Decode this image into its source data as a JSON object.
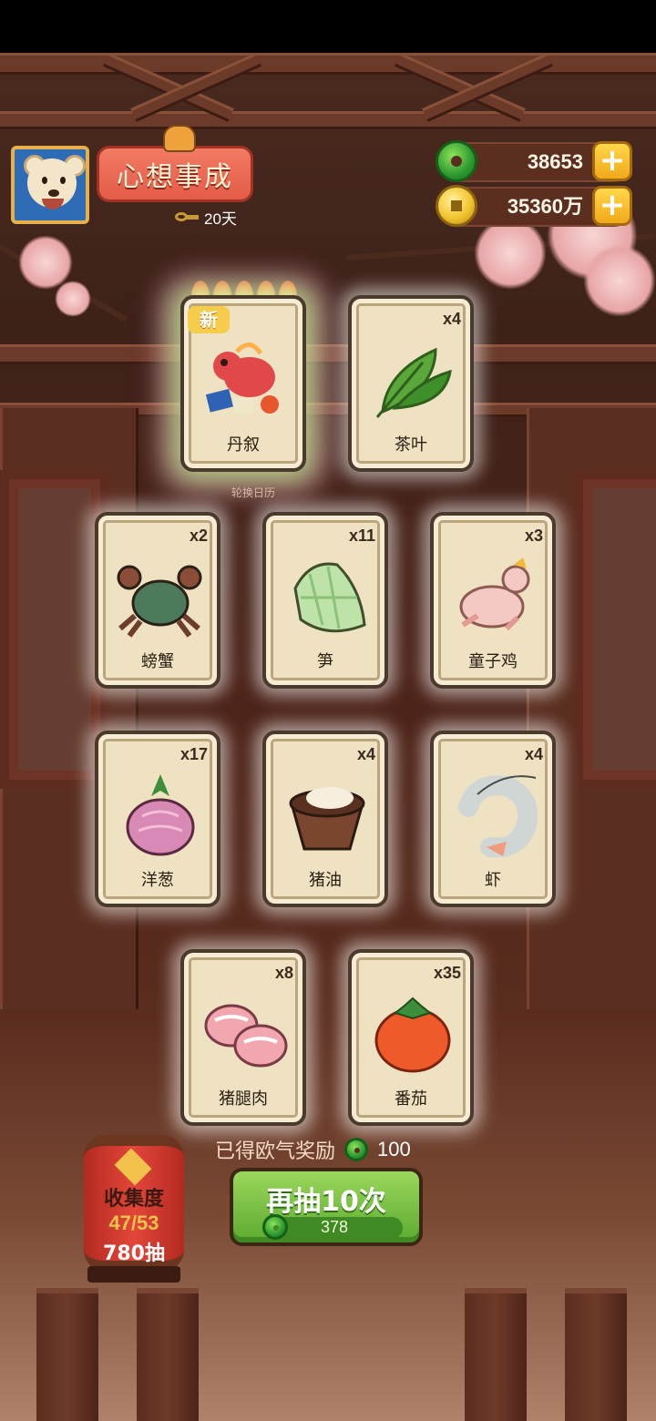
{
  "header": {
    "title": "心想事成",
    "days": "20天",
    "jade_amount": "38653",
    "coin_amount": "35360万"
  },
  "featured": {
    "new_label": "新",
    "caption": "轮换日历"
  },
  "cards": [
    {
      "name": "丹叙",
      "count": "",
      "icon": "red-dragon-icon"
    },
    {
      "name": "茶叶",
      "count": "x4",
      "icon": "tea-leaf-icon"
    },
    {
      "name": "螃蟹",
      "count": "x2",
      "icon": "crab-icon"
    },
    {
      "name": "笋",
      "count": "x11",
      "icon": "bamboo-shoot-icon"
    },
    {
      "name": "童子鸡",
      "count": "x3",
      "icon": "chicken-icon"
    },
    {
      "name": "洋葱",
      "count": "x17",
      "icon": "onion-icon"
    },
    {
      "name": "猪油",
      "count": "x4",
      "icon": "lard-icon"
    },
    {
      "name": "虾",
      "count": "x4",
      "icon": "shrimp-icon"
    },
    {
      "name": "猪腿肉",
      "count": "x8",
      "icon": "pork-leg-icon"
    },
    {
      "name": "番茄",
      "count": "x35",
      "icon": "tomato-icon"
    }
  ],
  "reward": {
    "label": "已得欧气奖励",
    "amount": "100"
  },
  "draw_button": {
    "label": "再抽10次",
    "cost": "378"
  },
  "collection": {
    "label": "收集度",
    "progress": "47/53",
    "draws": "780抽"
  },
  "colors": {
    "jade": "#2c9a2f",
    "coin": "#f2c42e",
    "button_green": "#5bab2f",
    "banner_red": "#e45c48"
  }
}
